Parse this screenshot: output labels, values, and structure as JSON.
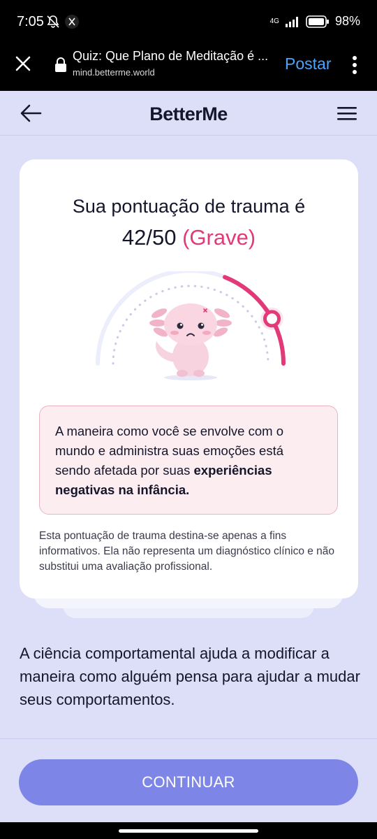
{
  "status_bar": {
    "time": "7:05",
    "battery": "98%",
    "network": "4G"
  },
  "browser": {
    "page_title": "Quiz: Que Plano de Meditação é ...",
    "url": "mind.betterme.world",
    "post_label": "Postar"
  },
  "header": {
    "logo": "BetterMe"
  },
  "result": {
    "label": "Sua pontuação de trauma é",
    "score": "42/50",
    "severity": "(Grave)",
    "gauge_fraction": 0.84,
    "alert_text_plain": "A maneira como você se envolve com o mundo e administra suas emoções está sendo afetada por suas ",
    "alert_text_bold": "experiências negativas na infância.",
    "disclaimer": "Esta pontuação de trauma destina-se apenas a fins informativos. Ela não representa um diagnóstico clínico e não substitui uma avaliação profissional."
  },
  "science_text": "A ciência comportamental ajuda a modificar a maneira como alguém pensa para ajudar a mudar seus comportamentos.",
  "continue_label": "CONTINUAR",
  "colors": {
    "accent": "#e23a78",
    "button": "#7d86e7",
    "background": "#dcdff7"
  }
}
